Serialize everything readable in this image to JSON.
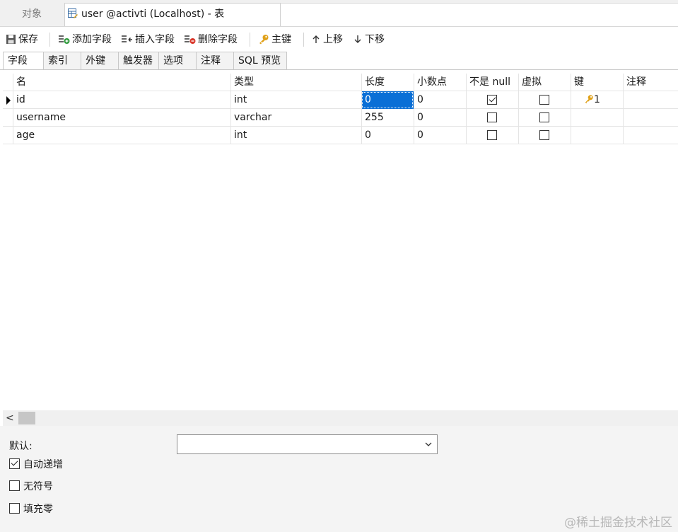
{
  "tabs": {
    "objects_label": "对象",
    "active_label": "user @activti (Localhost) - 表"
  },
  "toolbar": {
    "save": "保存",
    "add_field": "添加字段",
    "insert_field": "插入字段",
    "delete_field": "删除字段",
    "primary_key": "主键",
    "move_up": "上移",
    "move_down": "下移"
  },
  "subtabs": [
    "字段",
    "索引",
    "外键",
    "触发器",
    "选项",
    "注释",
    "SQL 预览"
  ],
  "columns": [
    "名",
    "类型",
    "长度",
    "小数点",
    "不是 null",
    "虚拟",
    "键",
    "注释"
  ],
  "rows": [
    {
      "name": "id",
      "type": "int",
      "length": "0",
      "decimals": "0",
      "not_null": true,
      "virtual": false,
      "key": "1",
      "comment": ""
    },
    {
      "name": "username",
      "type": "varchar",
      "length": "255",
      "decimals": "0",
      "not_null": false,
      "virtual": false,
      "key": "",
      "comment": ""
    },
    {
      "name": "age",
      "type": "int",
      "length": "0",
      "decimals": "0",
      "not_null": false,
      "virtual": false,
      "key": "",
      "comment": ""
    }
  ],
  "scroll_left_glyph": "<",
  "bottom": {
    "default_label": "默认:",
    "default_value": "",
    "auto_increment": {
      "label": "自动递增",
      "checked": true
    },
    "unsigned": {
      "label": "无符号",
      "checked": false
    },
    "zerofill": {
      "label": "填充零",
      "checked": false
    }
  },
  "watermark": "@稀土掘金技术社区",
  "colors": {
    "selection": "#0a6fd6",
    "key_icon": "#e0a21b"
  }
}
